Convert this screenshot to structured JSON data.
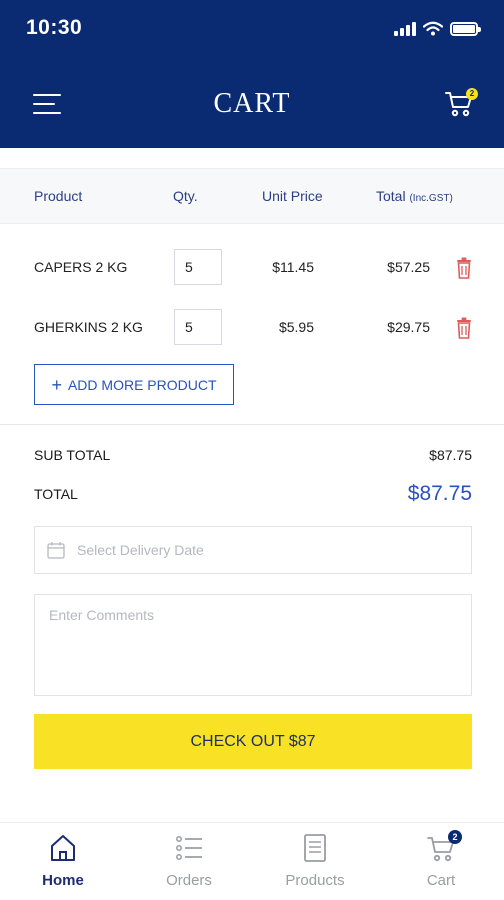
{
  "status_bar": {
    "time": "10:30"
  },
  "header": {
    "title": "CART",
    "cart_badge": "2"
  },
  "table": {
    "headers": {
      "product": "Product",
      "qty": "Qty.",
      "unit_price": "Unit Price",
      "total": "Total",
      "total_suffix": "(Inc.GST)"
    },
    "rows": [
      {
        "name": "CAPERS 2 KG",
        "qty": "5",
        "unit_price": "$11.45",
        "total": "$57.25"
      },
      {
        "name": "GHERKINS 2 KG",
        "qty": "5",
        "unit_price": "$5.95",
        "total": "$29.75"
      }
    ]
  },
  "add_more_label": "ADD MORE PRODUCT",
  "summary": {
    "sub_total_label": "SUB TOTAL",
    "sub_total_value": "$87.75",
    "total_label": "TOTAL",
    "total_value": "$87.75"
  },
  "delivery_date": {
    "placeholder": "Select Delivery Date"
  },
  "comments": {
    "placeholder": "Enter Comments"
  },
  "checkout_label": "CHECK OUT $87",
  "bottom_nav": {
    "items": [
      {
        "label": "Home",
        "icon": "home-icon",
        "active": true
      },
      {
        "label": "Orders",
        "icon": "list-icon",
        "active": false
      },
      {
        "label": "Products",
        "icon": "document-icon",
        "active": false
      },
      {
        "label": "Cart",
        "icon": "cart-icon",
        "active": false,
        "badge": "2"
      }
    ]
  },
  "colors": {
    "primary": "#0a2a72",
    "accent_blue": "#2a52be",
    "checkout_yellow": "#f9e225",
    "delete_red": "#e05a5a"
  }
}
